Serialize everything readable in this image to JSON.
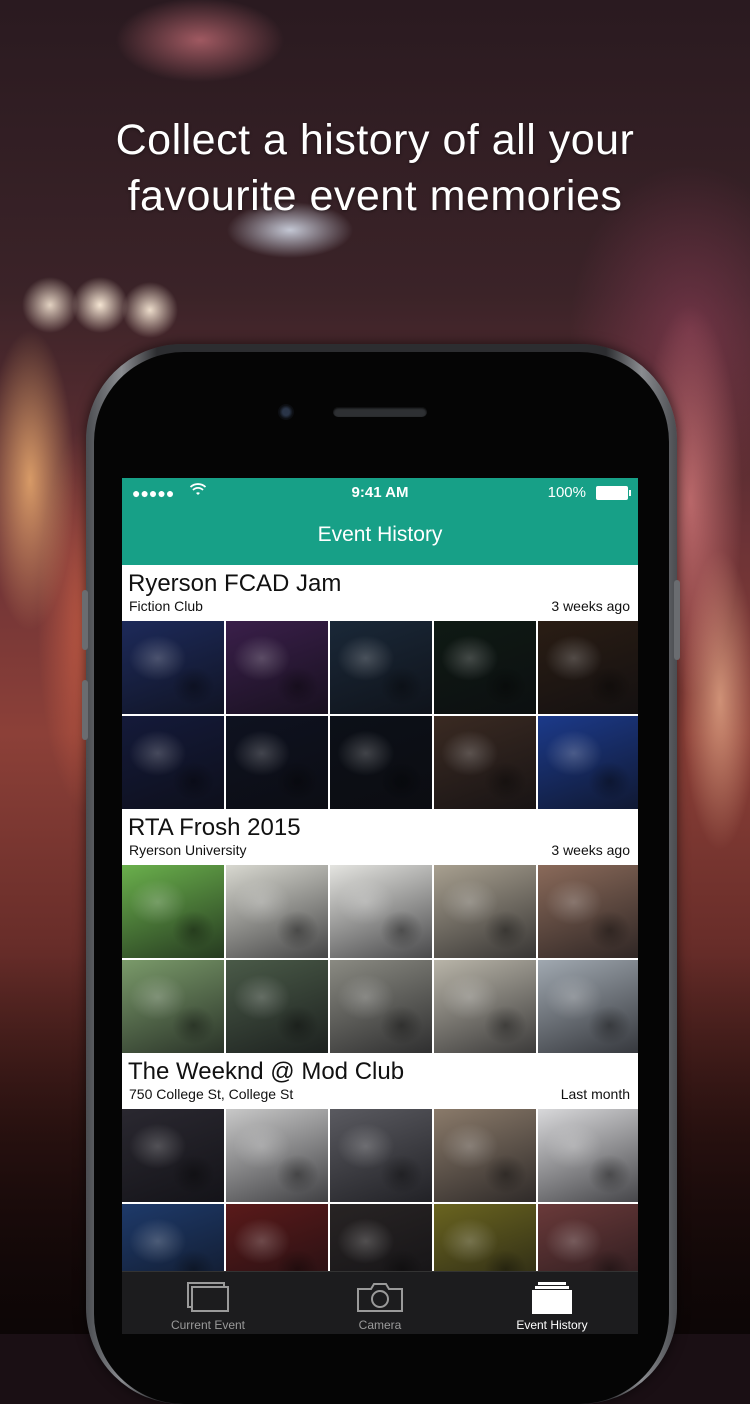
{
  "promo": {
    "headline_line1": "Collect a history of all your",
    "headline_line2": "favourite event memories"
  },
  "status_bar": {
    "signal": "●●●●●",
    "wifi": "wifi",
    "time": "9:41 AM",
    "battery": "100%"
  },
  "nav": {
    "title": "Event History"
  },
  "events": [
    {
      "title": "Ryerson FCAD Jam",
      "venue": "Fiction Club",
      "time": "3 weeks ago",
      "photos": [
        "#1d2a5a",
        "#3a1f4a",
        "#1a2838",
        "#0f1a14",
        "#2a1d14",
        "#141a3a",
        "#0e1220",
        "#0c1018",
        "#3a2a22",
        "#1c3a8a"
      ]
    },
    {
      "title": "RTA Frosh 2015",
      "venue": "Ryerson University",
      "time": "3 weeks ago",
      "photos": [
        "#6ab04c",
        "#d8d8d0",
        "#e4e4e0",
        "#a8a090",
        "#8a6a5a",
        "#7a9a6a",
        "#4a5a48",
        "#8a8a82",
        "#b8b4a8",
        "#a0a8b0"
      ]
    },
    {
      "title": "The Weeknd @ Mod Club",
      "venue": "750 College St, College St",
      "time": "Last month",
      "photos": [
        "#2a2830",
        "#c8c8c8",
        "#5a5a60",
        "#8a7a6a",
        "#d8d8da",
        "#1e3a6a",
        "#5a1a1a",
        "#282424",
        "#6a6420",
        "#6a3a3a"
      ]
    }
  ],
  "tabbar": {
    "tabs": [
      {
        "label": "Current Event",
        "active": false
      },
      {
        "label": "Camera",
        "active": false
      },
      {
        "label": "Event History",
        "active": true
      }
    ]
  },
  "colors": {
    "accent": "#17a087",
    "tabbar_bg": "#1c1c1e"
  }
}
